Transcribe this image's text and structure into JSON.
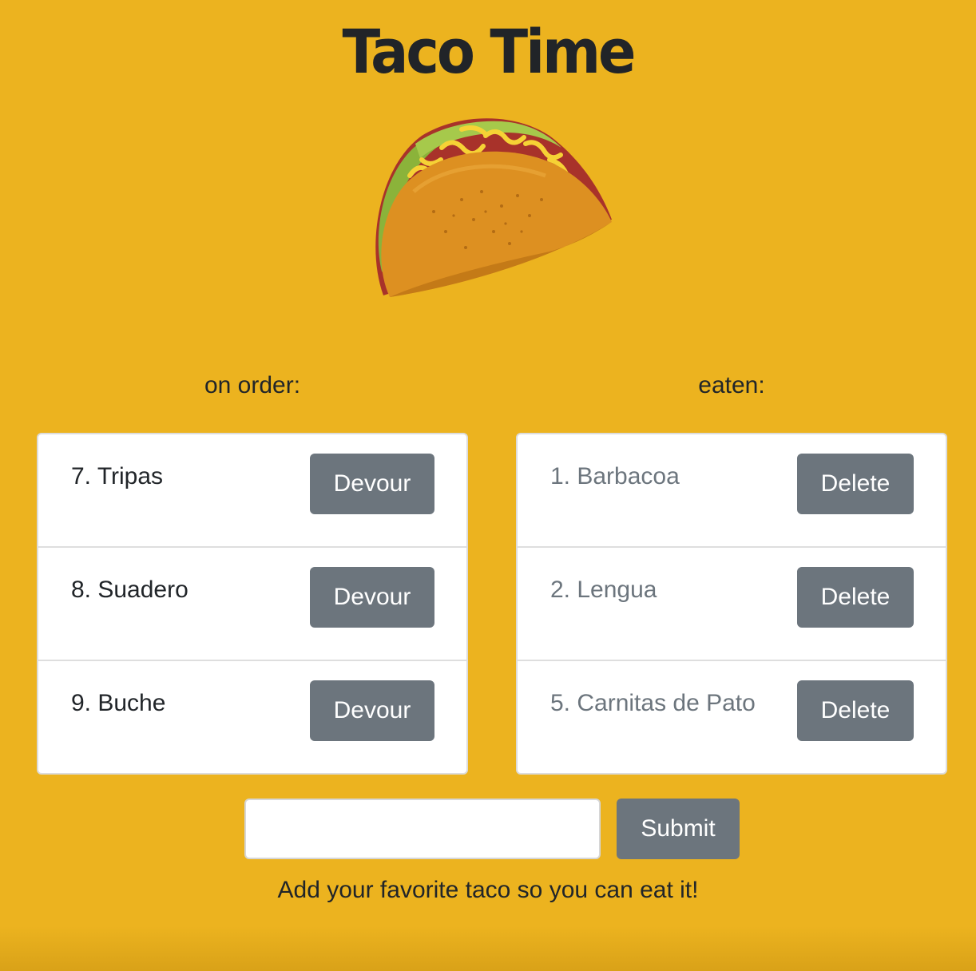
{
  "header": {
    "title": "Taco Time"
  },
  "on_order": {
    "heading": "on order:",
    "items": [
      {
        "label": "7. Tripas",
        "action": "Devour"
      },
      {
        "label": "8. Suadero",
        "action": "Devour"
      },
      {
        "label": "9. Buche",
        "action": "Devour"
      }
    ]
  },
  "eaten": {
    "heading": "eaten:",
    "items": [
      {
        "label": "1. Barbacoa",
        "action": "Delete"
      },
      {
        "label": "2. Lengua",
        "action": "Delete"
      },
      {
        "label": "5. Carnitas de Pato",
        "action": "Delete"
      }
    ]
  },
  "form": {
    "input_value": "",
    "input_placeholder": "",
    "submit_label": "Submit",
    "hint": "Add your favorite taco so you can eat it!"
  },
  "colors": {
    "background": "#ecb31f",
    "button": "#6c757d",
    "card": "#ffffff"
  }
}
